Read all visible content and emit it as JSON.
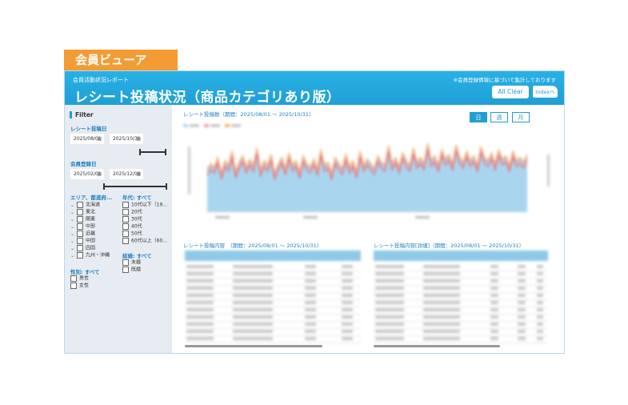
{
  "viewer_tab": "会員ビューア",
  "header": {
    "subtitle": "会員活動状況レポート",
    "title": "レシート投稿状況（商品カテゴリあり版）",
    "note": "※会員登録情報に基づいて集計しております",
    "all_clear": "All Clear",
    "index": "Indexへ"
  },
  "filter": {
    "title": "Filter",
    "receipt_date_label": "レシート投稿日",
    "receipt_from": "2025/08/01",
    "receipt_to": "2025/10/31",
    "member_date_label": "会員登録日",
    "member_from": "2025/02/01",
    "member_to": "2025/12/09",
    "area_label": "エリア、都道府...",
    "areas": [
      "北海道",
      "東北",
      "関東",
      "中部",
      "近畿",
      "中国",
      "四国",
      "九州・沖縄"
    ],
    "age_label": "年代: すべて",
    "ages": [
      "10代以下（19...",
      "20代",
      "30代",
      "40代",
      "50代",
      "60代以上（60..."
    ],
    "marriage_label": "結婚: すべて",
    "marriage": [
      "未婚",
      "既婚"
    ],
    "gender_label": "性別: すべて",
    "genders": [
      "男性",
      "女性"
    ]
  },
  "chart": {
    "title": "レシート投稿数（期間：2025/08/01 ～ 2025/10/31）",
    "buttons": [
      "日",
      "週",
      "月"
    ],
    "active_button": "日",
    "colors": {
      "area": "#a9d5ef",
      "line_orange": "#f2b25a",
      "line_pink": "#f29bb0",
      "line_red": "#e86a6a"
    }
  },
  "chart_data": {
    "type": "area",
    "title": "レシート投稿数（期間：2025/08/01 ～ 2025/10/31）",
    "series": [
      {
        "values": [
          0.55,
          0.62,
          0.58,
          0.7,
          0.5,
          0.66,
          0.6,
          0.78,
          0.52,
          0.64,
          0.72,
          0.58,
          0.68,
          0.6,
          0.82,
          0.54,
          0.66,
          0.6,
          0.74,
          0.5,
          0.62,
          0.7,
          0.56,
          0.76,
          0.6,
          0.66,
          0.52,
          0.72,
          0.62,
          0.58,
          0.68,
          0.55,
          0.8,
          0.6,
          0.64,
          0.5,
          0.7,
          0.62,
          0.56,
          0.74,
          0.58,
          0.66,
          0.52,
          0.78,
          0.6,
          0.68,
          0.62,
          0.56,
          0.72,
          0.64,
          0.6,
          0.85,
          0.62,
          0.7,
          0.58,
          0.76,
          0.66,
          0.6,
          0.82,
          0.64,
          0.7,
          0.62,
          0.88,
          0.66,
          0.72,
          0.6,
          0.8,
          0.68,
          0.74,
          0.62,
          0.86,
          0.7,
          0.64,
          0.78,
          0.66,
          0.72,
          0.6,
          0.84,
          0.7,
          0.66,
          0.76,
          0.62,
          0.8,
          0.68,
          0.72,
          0.6,
          0.78,
          0.66,
          0.7,
          0.64,
          0.74
        ]
      }
    ]
  },
  "table1": {
    "title": "レシート投稿内容　（期間：2025/08/01 ～ 2025/10/31）"
  },
  "table2": {
    "title": "レシート投稿内容[詳細]（期間：2025/08/01 ～ 2025/10/31）"
  }
}
